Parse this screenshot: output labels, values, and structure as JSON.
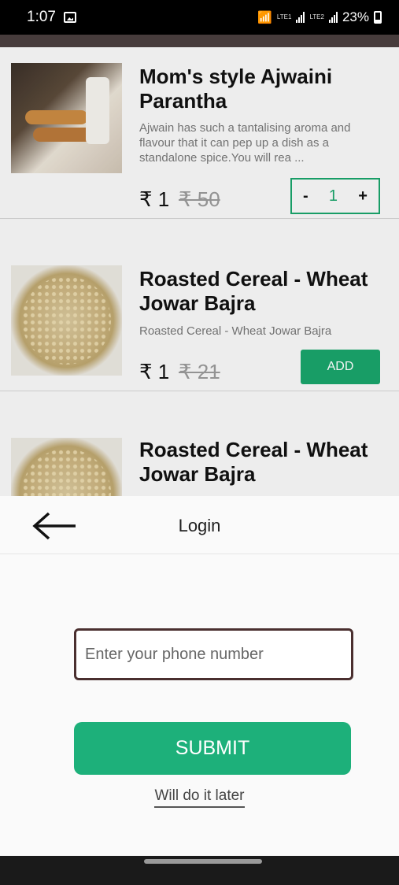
{
  "status_bar": {
    "time": "1:07",
    "lte1": "LTE1",
    "lte2": "LTE2",
    "battery": "23%"
  },
  "products": [
    {
      "title": "Mom's style Ajwaini Parantha",
      "description": "Ajwain has such a tantalising aroma and flavour that it can pep up a dish as a standalone spice.You will rea ...",
      "price": "₹ 1",
      "mrp": "₹ 50",
      "quantity": "1",
      "minus": "-",
      "plus": "+"
    },
    {
      "title": "Roasted Cereal - Wheat Jowar Bajra",
      "description": "Roasted Cereal - Wheat Jowar Bajra",
      "price": "₹ 1",
      "mrp": "₹ 21",
      "add_label": "ADD"
    },
    {
      "title": "Roasted Cereal - Wheat Jowar Bajra"
    }
  ],
  "login_sheet": {
    "title": "Login",
    "phone_placeholder": "Enter your phone number",
    "phone_value": "",
    "submit_label": "SUBMIT",
    "later_label": "Will do it later"
  },
  "colors": {
    "accent_green": "#1db07a",
    "input_border": "#4a2f2f"
  },
  "icons": [
    "image-icon",
    "wifi-icon",
    "signal-icon",
    "battery-icon",
    "back-arrow-icon"
  ]
}
